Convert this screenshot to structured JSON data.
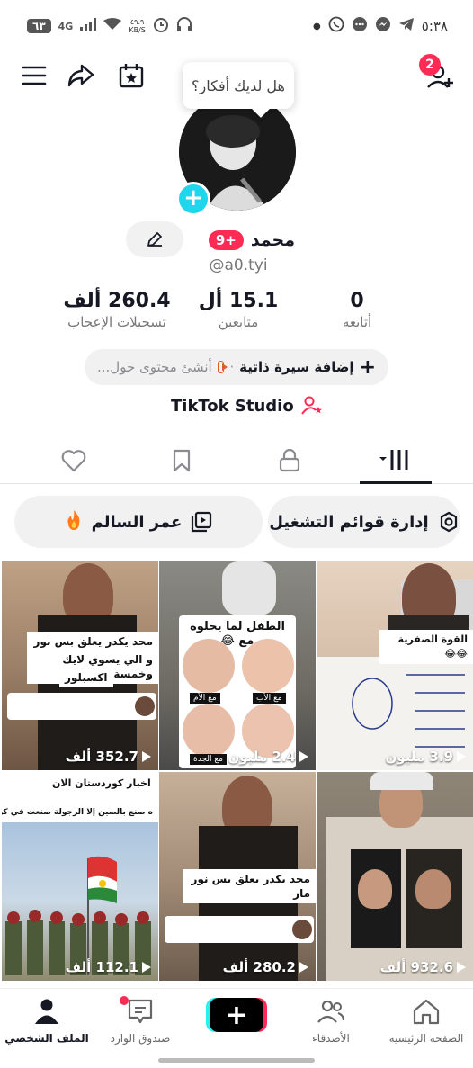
{
  "status_bar": {
    "time": "٥:٣٨",
    "battery": "٦٣",
    "network": "4G",
    "speed_value": "٤٩.٩",
    "speed_unit": "KB/S"
  },
  "top": {
    "notification_count": "2",
    "idea_bubble": "هل لديك أفكار؟"
  },
  "profile": {
    "name": "محمد",
    "badge": "9+",
    "username": "@a0.tyi"
  },
  "stats": [
    {
      "value": "0",
      "label": "أتابعه"
    },
    {
      "value": "15.1 أل",
      "label": "متابعين"
    },
    {
      "value": "260.4 ألف",
      "label": "تسجيلات الإعجاب"
    }
  ],
  "bio": {
    "add_label": "إضافة سيرة ذاتية",
    "suggestion": "أنشئ محتوى حول..."
  },
  "studio_label": "TikTok Studio",
  "playlist_buttons": {
    "manage": "إدارة قوائم التشغيل",
    "playlist": "عمر السالم"
  },
  "videos": [
    {
      "views": "352.7 ألف",
      "overlay": "محد يكدر يعلق بس نور مار",
      "overlay2": "و الي يسوي لايك وخمسة",
      "overlay3": "اكسبلور"
    },
    {
      "views": "2.4 مليون",
      "overlay": "الطفل لما يخلوه مع 😂",
      "labels": [
        "مع الأم",
        "مع الأب",
        "مع الجدة"
      ]
    },
    {
      "views": "3.9 مليون",
      "overlay": "القوة الصفرية 😂😂"
    },
    {
      "views": "112.1 ألف",
      "overlay": "اخبار كوردستان الان",
      "overlay2": "ه صنع بالصين إلا الرجولة صنعت في كوردستان"
    },
    {
      "views": "280.2 ألف",
      "overlay": "محد يكدر يعلق بس نور مار"
    },
    {
      "views": "932.6 ألف"
    }
  ],
  "bottom_nav": {
    "home": "الصفحة الرئيسية",
    "friends": "الأصدقاء",
    "inbox": "صندوق الوارد",
    "profile": "الملف الشخصي"
  },
  "colors": {
    "brand_red": "#fe2c55",
    "brand_cyan": "#25f4ee",
    "avatar_plus": "#20d5ec"
  }
}
